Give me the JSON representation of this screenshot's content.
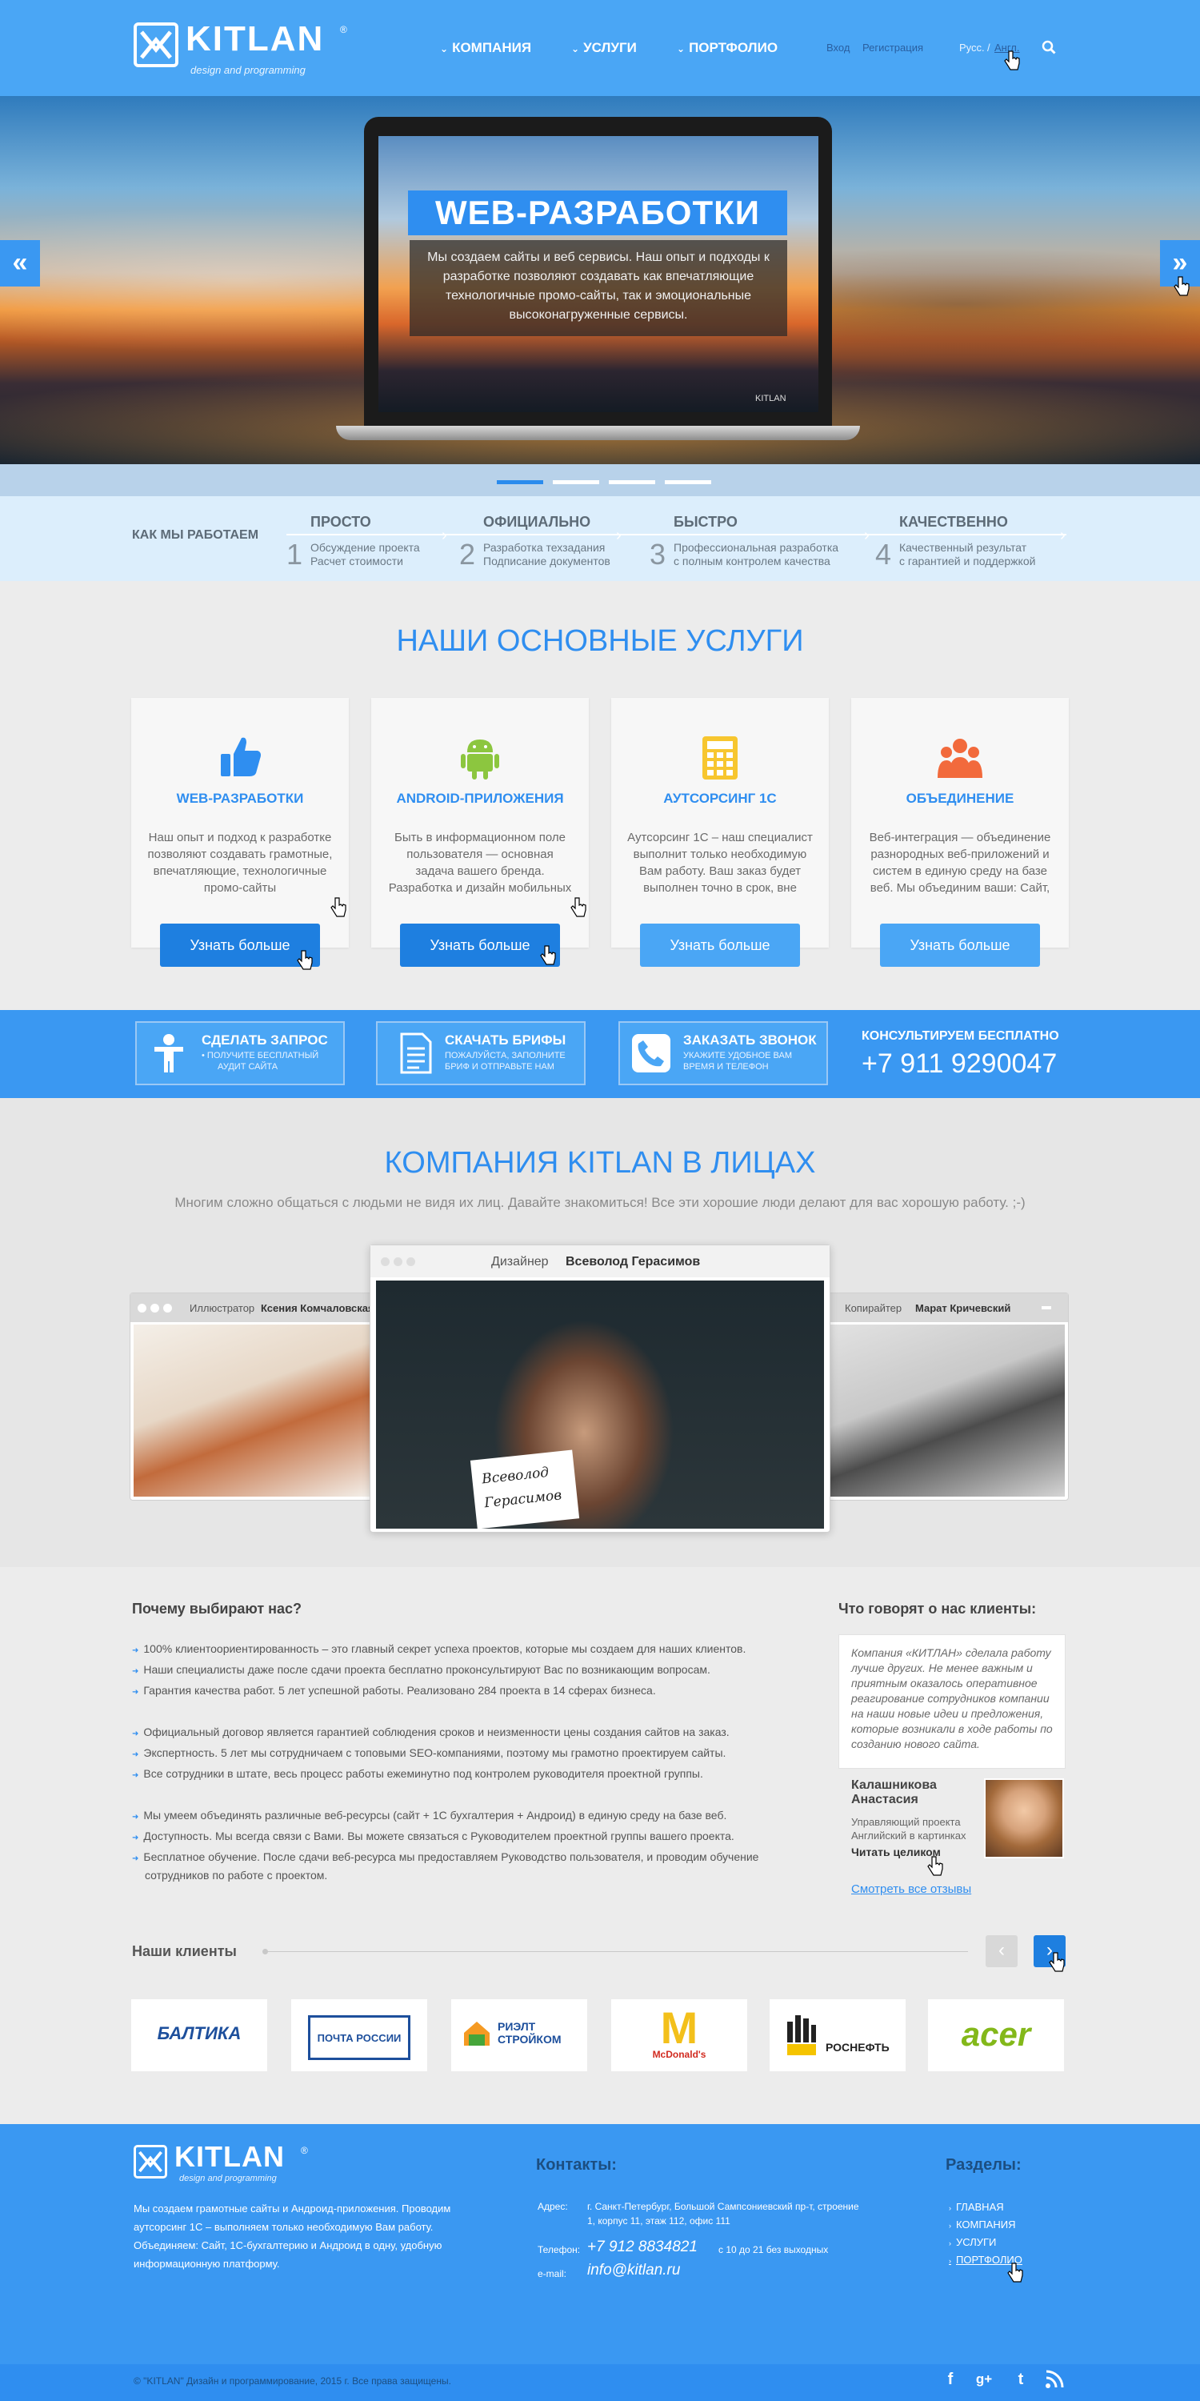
{
  "header": {
    "logo": "KITLAN",
    "logo_reg": "®",
    "logo_sub": "design and programming",
    "nav": [
      "КОМПАНИЯ",
      "УСЛУГИ",
      "ПОРТФОЛИО"
    ],
    "login": "Вход",
    "register": "Регистрация",
    "lang_ru": "Русс.",
    "lang_sep": "/",
    "lang_en": "Англ."
  },
  "hero": {
    "title": "WEB-РАЗРАБОТКИ",
    "text": "Мы создаем сайты и веб сервисы. Наш опыт и подходы к разработке позволяют создавать как впечатляющие технологичные промо-сайты, так и эмоциональные высоконагруженные сервисы.",
    "prev": "«",
    "next": "»",
    "watermark": "KITLAN"
  },
  "work": {
    "title": "КАК МЫ РАБОТАЕМ",
    "steps": [
      {
        "num": "1",
        "head": "ПРОСТО",
        "line1": "Обсуждение проекта",
        "line2": "Расчет стоимости"
      },
      {
        "num": "2",
        "head": "ОФИЦИАЛЬНО",
        "line1": "Разработка техзадания",
        "line2": "Подписание документов"
      },
      {
        "num": "3",
        "head": "БЫСТРО",
        "line1": "Профессиональная разработка",
        "line2": "с полным контролем качества"
      },
      {
        "num": "4",
        "head": "КАЧЕСТВЕННО",
        "line1": "Качественный результат",
        "line2": "с гарантией и поддержкой"
      }
    ]
  },
  "services": {
    "title": "НАШИ ОСНОВНЫЕ УСЛУГИ",
    "button": "Узнать больше",
    "cards": [
      {
        "title": "WEB-РАЗРАБОТКИ",
        "icon": "thumbs-up-icon",
        "text": "Наш опыт и подход к разработке позволяют создавать грамотные, впечатляющие, технологичные промо-сайты"
      },
      {
        "title": "ANDROID-ПРИЛОЖЕНИЯ",
        "icon": "android-icon",
        "text": "Быть в информационном поле пользователя — основная задача вашего бренда. Разработка и дизайн мобильных"
      },
      {
        "title": "АУТСОРСИНГ 1С",
        "icon": "calculator-icon",
        "text": "Аутсорсинг 1С – наш специалист выполнит только необходимую Вам работу. Ваш заказ будет выполнен точно в срок, вне"
      },
      {
        "title": "ОБЪЕДИНЕНИЕ",
        "icon": "people-icon",
        "text": "Веб-интеграция — объединение разнородных веб-приложений и систем в единую среду на базе веб. Мы объединим ваши: Сайт,"
      }
    ]
  },
  "cta": {
    "boxes": [
      {
        "title": "СДЕЛАТЬ ЗАПРОС",
        "line1": "• ПОЛУЧИТЕ БЕСПЛАТНЫЙ",
        "line2": "АУДИТ САЙТА",
        "icon": "person-icon"
      },
      {
        "title": "СКАЧАТЬ БРИФЫ",
        "line1": "ПОЖАЛУЙСТА, ЗАПОЛНИТЕ",
        "line2": "БРИФ И ОТПРАВЬТЕ НАМ",
        "icon": "document-icon"
      },
      {
        "title": "ЗАКАЗАТЬ ЗВОНОК",
        "line1": "УКАЖИТЕ УДОБНОЕ ВАМ",
        "line2": "ВРЕМЯ И ТЕЛЕФОН",
        "icon": "phone-icon"
      }
    ],
    "consult": "КОНСУЛЬТИРУЕМ БЕСПЛАТНО",
    "phone": "+7 911 9290047"
  },
  "team": {
    "title": "КОМПАНИЯ KITLAN В ЛИЦАХ",
    "subtitle": "Многим сложно общаться с людьми не видя их лиц. Давайте знакомиться! Все эти хорошие люди делают для вас хорошую работу. ;-)",
    "members": [
      {
        "role": "Иллюстратор",
        "name": "Ксения Комчаловская"
      },
      {
        "role": "Дизайнер",
        "name": "Всеволод Герасимов"
      },
      {
        "role": "Копирайтер",
        "name": "Марат Кричевский"
      }
    ],
    "note_line1": "Всеволод",
    "note_line2": "Герасимов"
  },
  "why": {
    "title": "Почему выбирают нас?",
    "groups": [
      [
        "100% клиентоориентированность – это главный секрет успеха проектов, которые мы создаем для наших клиентов.",
        "Наши специалисты даже после сдачи проекта бесплатно проконсультируют Вас по возникающим вопросам.",
        "Гарантия качества работ. 5 лет успешной работы. Реализовано 284 проекта в 14 сферах бизнеса."
      ],
      [
        "Официальный договор является гарантией соблюдения сроков и неизменности цены создания сайтов на заказ.",
        "Экспертность. 5 лет мы сотрудничаем с топовыми SEO-компаниями, поэтому мы грамотно проектируем сайты.",
        "Все сотрудники в штате, весь процесс работы ежеминутно под контролем руководителя проектной группы."
      ],
      [
        "Мы умеем объединять различные веб-ресурсы (сайт + 1С бухгалтерия + Андроид) в единую среду на базе веб.",
        "Доступность. Мы всегда связи с Вами. Вы можете связаться с Руководителем проектной группы вашего проекта.",
        "Бесплатное обучение. После сдачи веб-ресурса мы предоставляем Руководство пользователя, и проводим обучение сотрудников по работе с проектом."
      ]
    ]
  },
  "reviews": {
    "title": "Что говорят о нас клиенты:",
    "text": "Компания «КИТЛАН» сделала работу лучше других. Не менее важным и приятным оказалось оперативное реагирование сотрудников компании на наши новые идеи и предложения, которые возникали в ходе работы по созданию нового сайта.",
    "name": "Калашникова Анастасия",
    "role": "Управляющий проекта Английский в картинках",
    "read": "Читать целиком",
    "all": "Смотреть все отзывы"
  },
  "clients": {
    "title": "Наши клиенты",
    "prev": "‹",
    "next": "›",
    "logos": [
      "БАЛТИКА",
      "ПОЧТА РОССИИ",
      "РИЭЛТ СТРОЙКОМ",
      "McDonald's",
      "РОСНЕФТЬ",
      "acer"
    ]
  },
  "footer": {
    "logo": "KITLAN",
    "logo_sub": "design and programming",
    "desc": "Мы создаем грамотные сайты и Андроид-приложения. Проводим аутсорсинг 1С – выполняем только необходимую Вам работу. Объединяем: Сайт, 1С-бухгалтерию и Андроид в одну, удобную информационную платформу.",
    "contacts_title": "Контакты:",
    "address_label": "Адрес:",
    "address": "г. Санкт-Петербург, Большой Сампсониевский пр-т, строение 1, корпус 11, этаж 112, офис 111",
    "phone_label": "Телефон:",
    "phone": "+7 912 8834821",
    "hours": "с 10 до 21 без выходных",
    "email_label": "e-mail:",
    "email": "info@kitlan.ru",
    "sections_title": "Разделы:",
    "sections": [
      "ГЛАВНАЯ",
      "КОМПАНИЯ",
      "УСЛУГИ",
      "ПОРТФОЛИО"
    ],
    "copyright": "© \"KITLAN\" Дизайн и программирование, 2015 г. Все права защищены.",
    "social": [
      "f",
      "g+",
      "t",
      "rss"
    ]
  },
  "colors": {
    "accent": "#2f8ef0",
    "header": "#4aa6f5",
    "button_dark": "#1e7fe0",
    "button_light": "#4aa6f5"
  }
}
